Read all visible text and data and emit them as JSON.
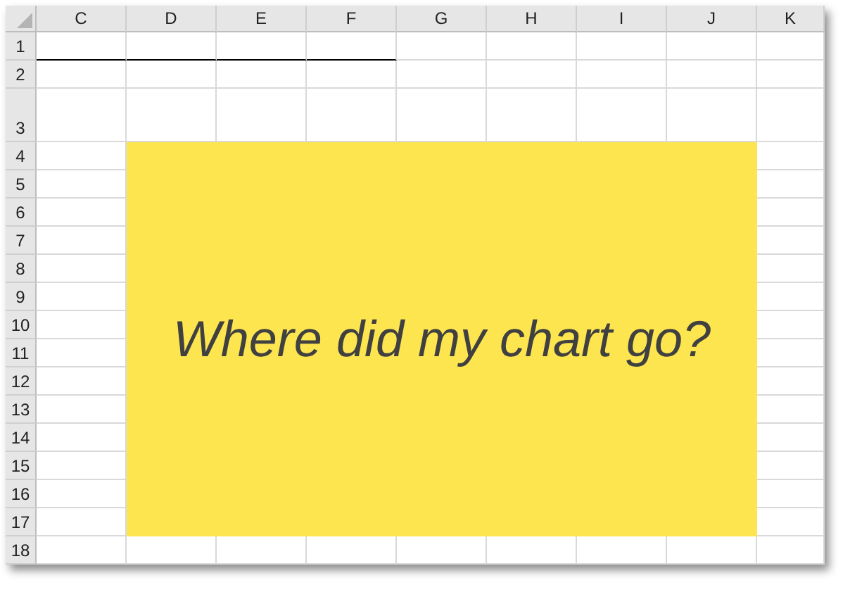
{
  "sheet": {
    "columns": [
      "C",
      "D",
      "E",
      "F",
      "G",
      "H",
      "I",
      "J",
      "K"
    ],
    "rows": [
      {
        "label": "1",
        "bottom_border": [
          true,
          true,
          true,
          true,
          false,
          false,
          false,
          false,
          false
        ]
      },
      {
        "label": "2"
      },
      {
        "label": "3"
      },
      {
        "label": "4"
      },
      {
        "label": "5"
      },
      {
        "label": "6"
      },
      {
        "label": "7"
      },
      {
        "label": "8"
      },
      {
        "label": "9"
      },
      {
        "label": "10"
      },
      {
        "label": "11"
      },
      {
        "label": "12"
      },
      {
        "label": "13"
      },
      {
        "label": "14"
      },
      {
        "label": "15"
      },
      {
        "label": "16"
      },
      {
        "label": "17"
      },
      {
        "label": "18"
      }
    ]
  },
  "shape": {
    "text": "Where did my chart go?"
  }
}
